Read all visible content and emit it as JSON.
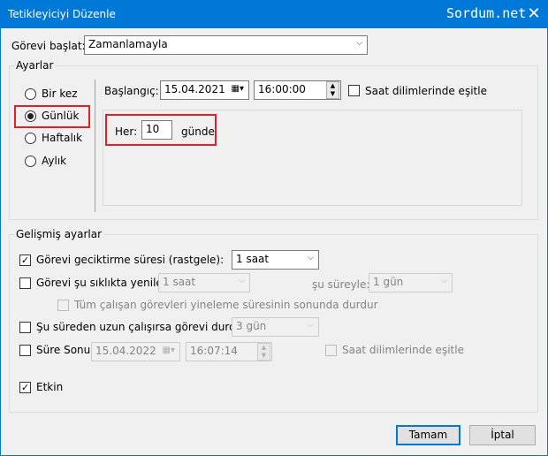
{
  "window": {
    "title": "Tetikleyiciyi Düzenle",
    "watermark": "Sordum.net",
    "close_glyph": "✕"
  },
  "task_start": {
    "label": "Görevi başlat:",
    "value": "Zamanlamayla"
  },
  "settings": {
    "legend": "Ayarlar",
    "radios": [
      {
        "label": "Bir kez",
        "checked": false
      },
      {
        "label": "Günlük",
        "checked": true
      },
      {
        "label": "Haftalık",
        "checked": false
      },
      {
        "label": "Aylık",
        "checked": false
      }
    ],
    "start_label": "Başlangıç:",
    "start_date": "15.04.2021",
    "start_time": "16:00:00",
    "sync_tz_label": "Saat dilimlerinde eşitle",
    "every_label": "Her:",
    "every_value": "10",
    "every_unit": "günde"
  },
  "advanced": {
    "legend": "Gelişmiş ayarlar",
    "delay_label": "Görevi geciktirme süresi (rastgele):",
    "delay_value": "1 saat",
    "repeat_label": "Görevi şu sıklıkta yenile:",
    "repeat_value": "1 saat",
    "duration_label": "şu süreyle:",
    "duration_value": "1 gün",
    "stop_all_label": "Tüm çalışan görevleri yineleme süresinin sonunda durdur",
    "stop_long_label": "Şu süreden uzun çalışırsa görevi durdur:",
    "stop_long_value": "3 gün",
    "expire_label": "Süre Sonu:",
    "expire_date": "15.04.2022",
    "expire_time": "16:07:14",
    "expire_tz_label": "Saat dilimlerinde eşitle",
    "enabled_label": "Etkin"
  },
  "buttons": {
    "ok": "Tamam",
    "cancel": "İptal"
  }
}
